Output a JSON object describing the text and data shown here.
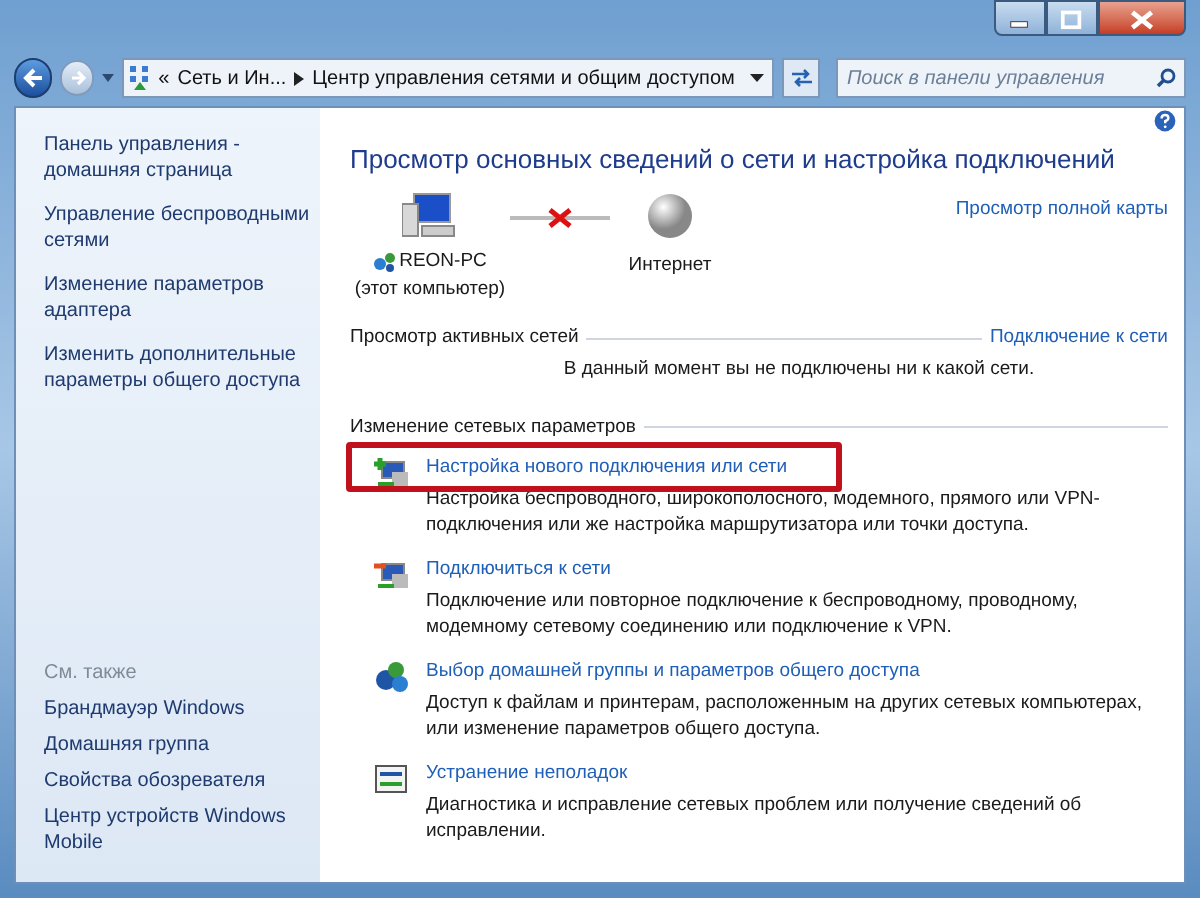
{
  "address_bar": {
    "crumbs": [
      "«",
      "Сеть и Ин...",
      "Центр управления сетями и общим доступом"
    ]
  },
  "search": {
    "placeholder": "Поиск в панели управления"
  },
  "sidebar": {
    "items": [
      {
        "label": "Панель управления - домашняя страница"
      },
      {
        "label": "Управление беспроводными сетями"
      },
      {
        "label": "Изменение параметров адаптера"
      },
      {
        "label": "Изменить дополнительные параметры общего доступа"
      }
    ],
    "see_also_title": "См. также",
    "see_also": [
      {
        "label": "Брандмауэр Windows"
      },
      {
        "label": "Домашняя группа"
      },
      {
        "label": "Свойства обозревателя"
      },
      {
        "label": "Центр устройств Windows Mobile"
      }
    ]
  },
  "main": {
    "title": "Просмотр основных сведений о сети и настройка подключений",
    "full_map_link": "Просмотр полной карты",
    "map": {
      "computer_name": "REON-PC",
      "computer_note": "(этот компьютер)",
      "internet": "Интернет",
      "connected": false
    },
    "active_networks": {
      "title": "Просмотр активных сетей",
      "link": "Подключение к сети",
      "message": "В данный момент вы не подключены ни к какой сети."
    },
    "change_title": "Изменение сетевых параметров",
    "tasks": [
      {
        "kind": "new",
        "title": "Настройка нового подключения или сети",
        "description": "Настройка беспроводного, широкополосного, модемного, прямого или VPN-подключения или же настройка маршрутизатора или точки доступа.",
        "highlighted": true
      },
      {
        "kind": "connect",
        "title": "Подключиться к сети",
        "description": "Подключение или повторное подключение к беспроводному, проводному, модемному сетевому соединению или подключение к VPN.",
        "highlighted": false
      },
      {
        "kind": "homegroup",
        "title": "Выбор домашней группы и параметров общего доступа",
        "description": "Доступ к файлам и принтерам, расположенным на других сетевых компьютерах, или изменение параметров общего доступа.",
        "highlighted": false
      },
      {
        "kind": "troubleshoot",
        "title": "Устранение неполадок",
        "description": "Диагностика и исправление сетевых проблем или получение сведений об исправлении.",
        "highlighted": false
      }
    ]
  }
}
